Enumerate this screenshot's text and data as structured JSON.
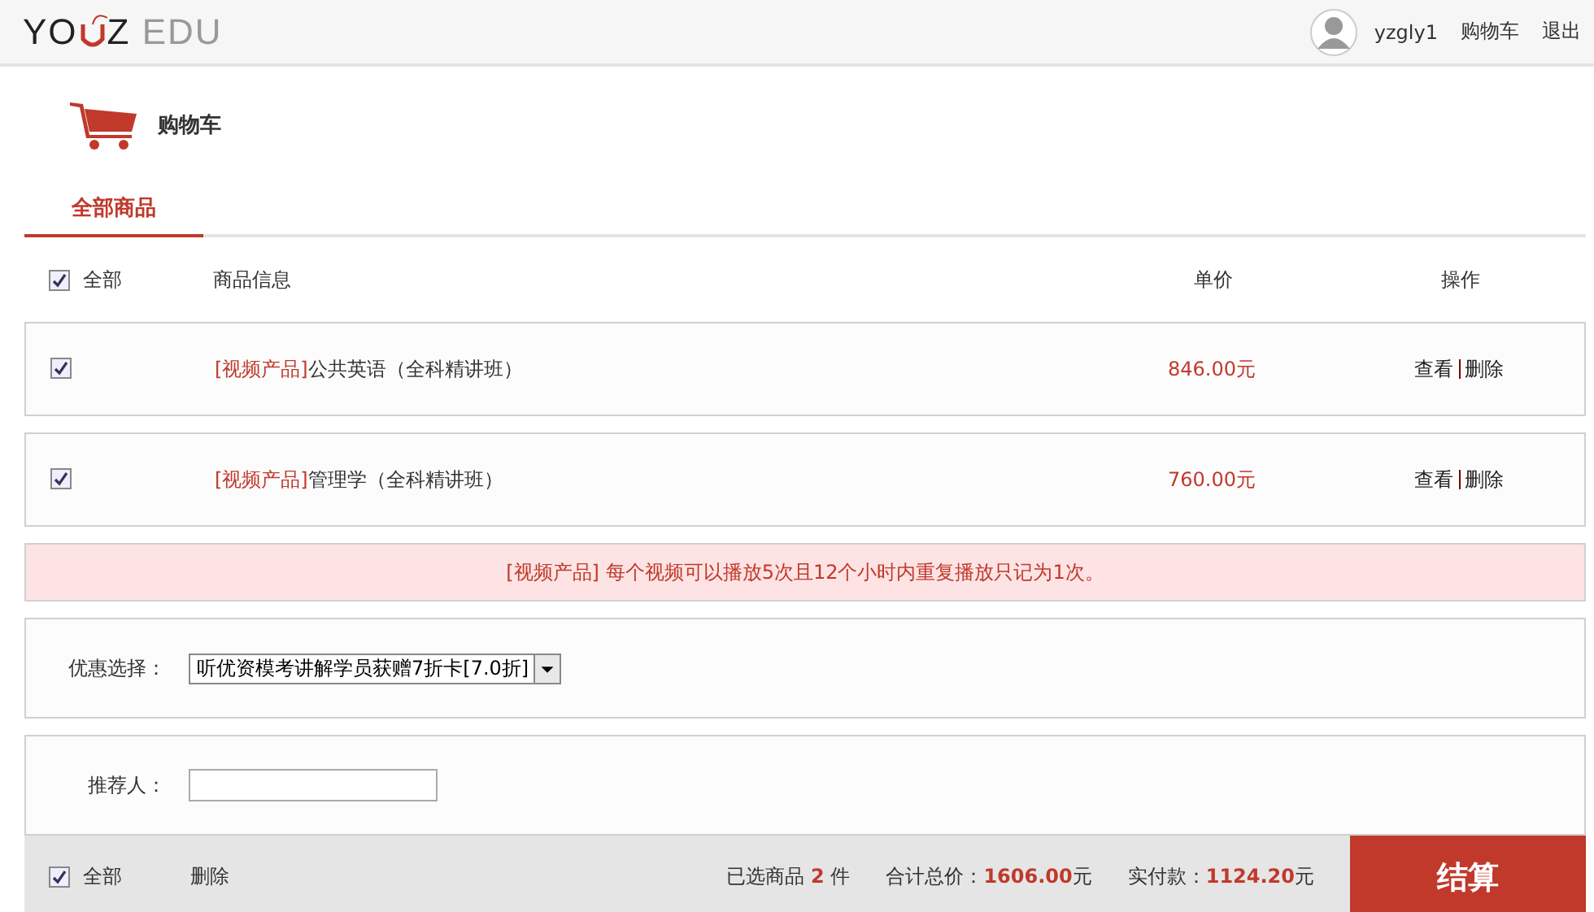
{
  "logo": {
    "left": "YO",
    "middle": "Z",
    "right": "EDU"
  },
  "user": {
    "name": "yzgly1",
    "links": [
      "购物车",
      "退出"
    ]
  },
  "page_title": "购物车",
  "tabs": [
    {
      "label": "全部商品",
      "selected": true
    }
  ],
  "header": {
    "select_all": {
      "label": "全部",
      "checked": true
    },
    "columns": [
      "商品信息",
      "单价",
      "操作"
    ]
  },
  "items": [
    {
      "checked": true,
      "tag": "[视频产品]",
      "name": "公共英语（全科精讲班）",
      "price": "846.00元",
      "actions": [
        "查看",
        "删除"
      ]
    },
    {
      "checked": true,
      "tag": "[视频产品]",
      "name": "管理学（全科精讲班）",
      "price": "760.00元",
      "actions": [
        "查看",
        "删除"
      ]
    }
  ],
  "notice": {
    "tag": "[视频产品]",
    "text": "每个视频可以播放5次且12个小时内重复播放只记为1次。"
  },
  "coupon": {
    "label": "优惠选择：",
    "value": "听优资模考讲解学员获赠7折卡[7.0折]"
  },
  "referrer": {
    "label": "推荐人："
  },
  "footer": {
    "select_all": {
      "label": "全部",
      "checked": true
    },
    "delete": "删除",
    "count": {
      "label": "已选商品",
      "value": "2",
      "unit": "件"
    },
    "total": {
      "label": "合计总价：",
      "value": "1606.00",
      "unit": "元"
    },
    "paid": {
      "label": "实付款：",
      "value": "1124.20",
      "unit": "元"
    },
    "checkout": "结算"
  }
}
